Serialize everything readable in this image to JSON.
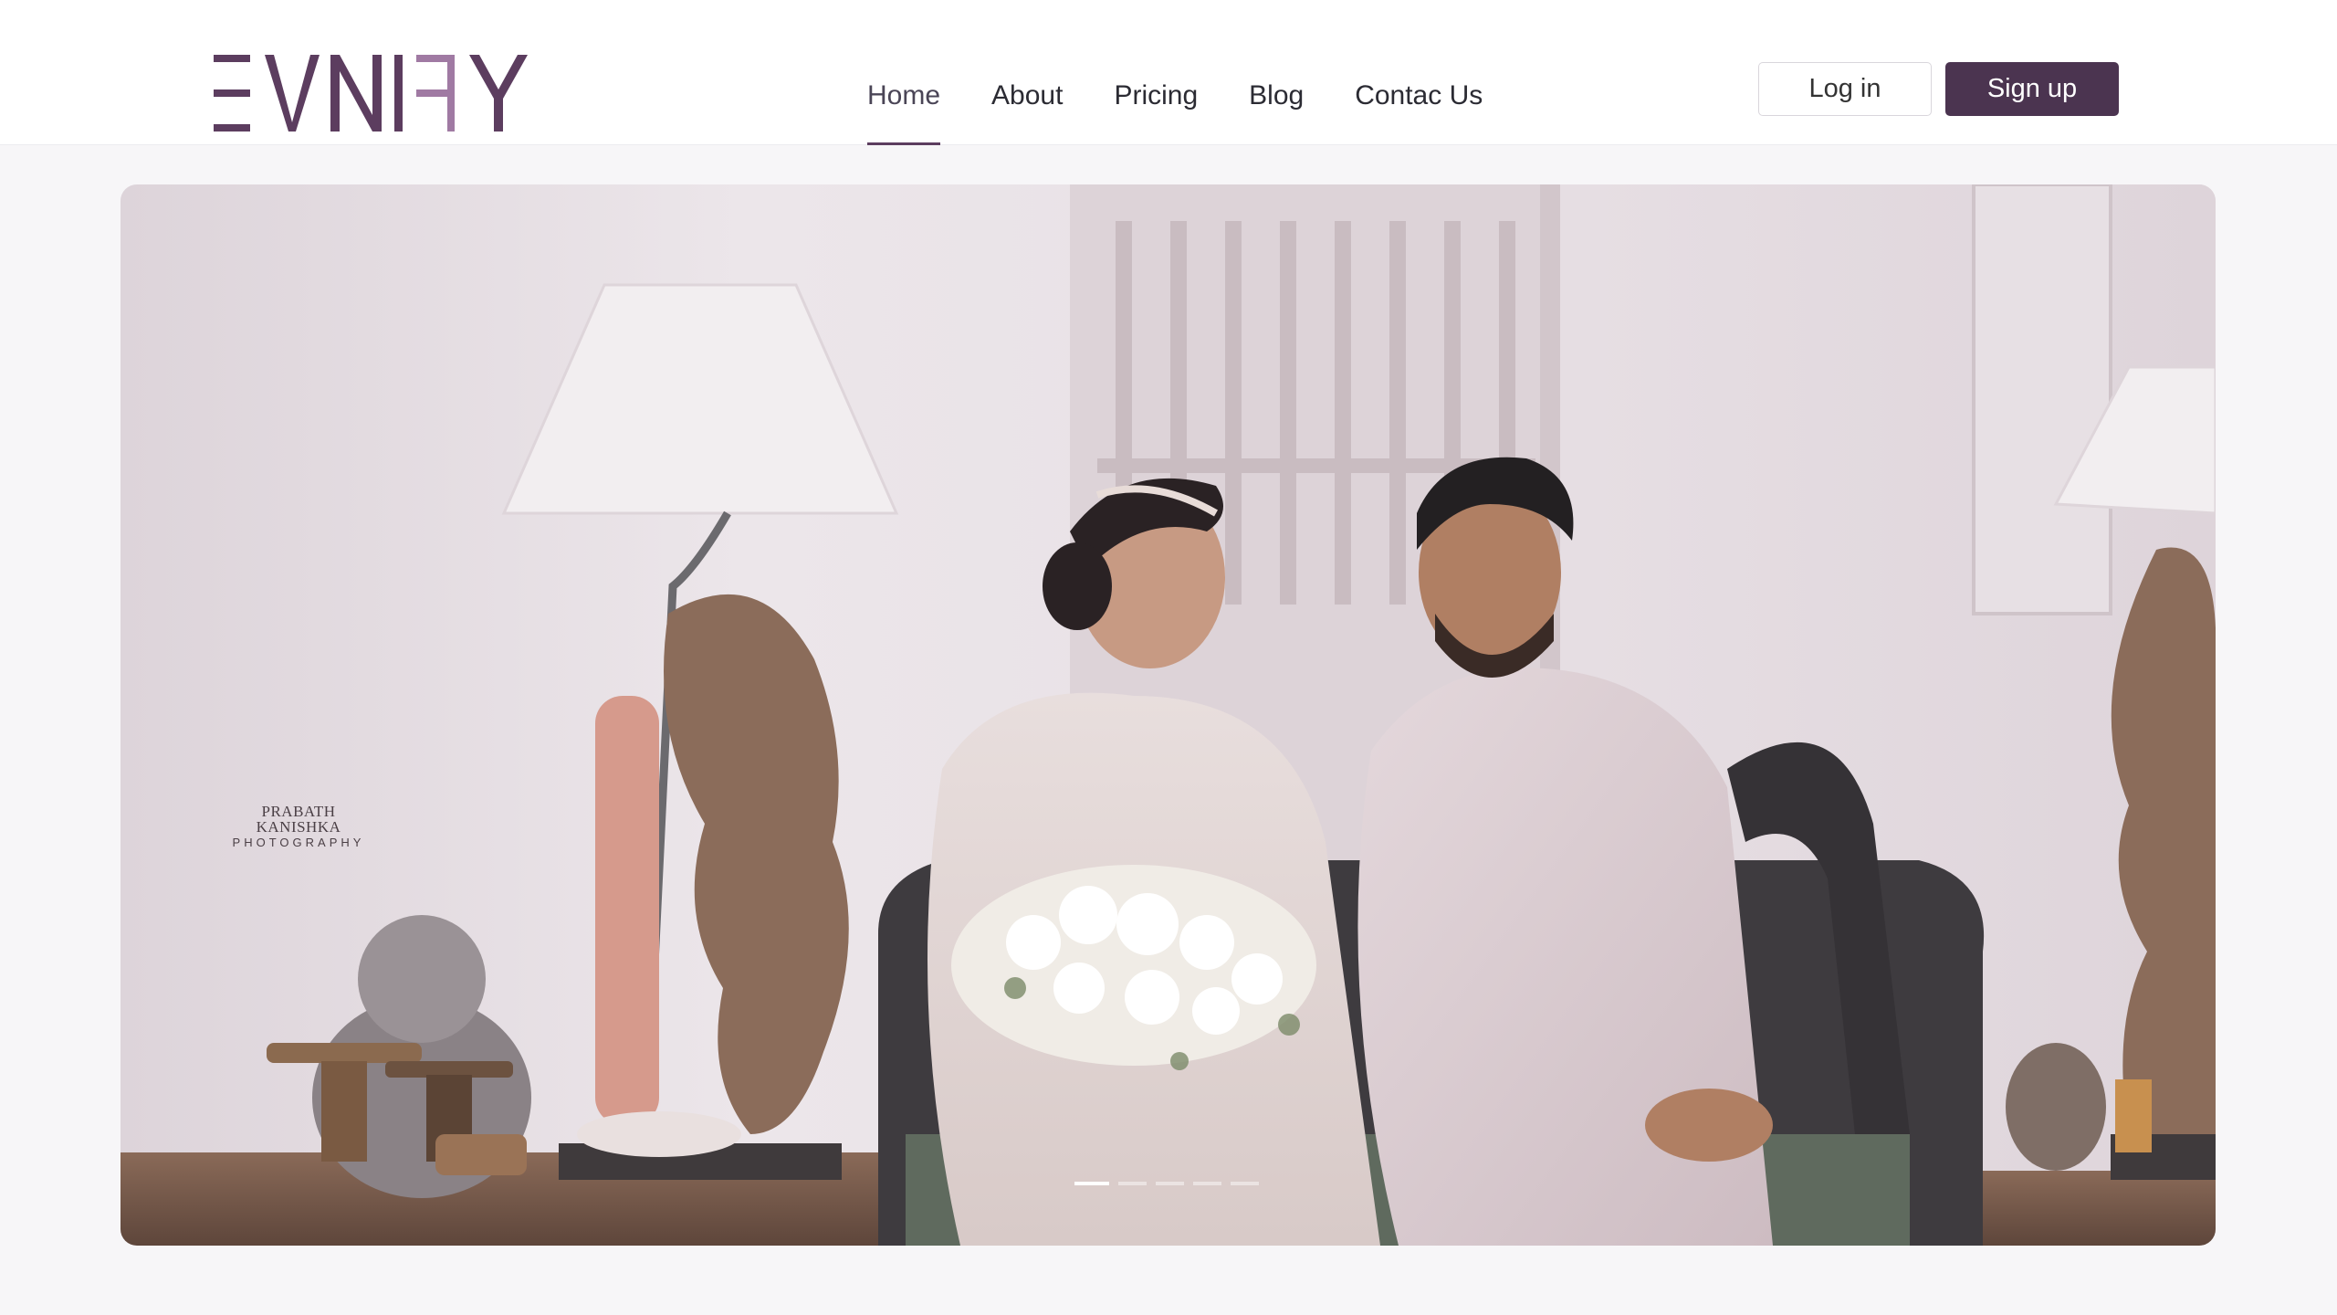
{
  "brand": {
    "logo_text": "EVNIFY",
    "color": "#5c3d5f"
  },
  "nav": {
    "items": [
      {
        "label": "Home",
        "active": true
      },
      {
        "label": "About"
      },
      {
        "label": "Pricing"
      },
      {
        "label": "Blog"
      },
      {
        "label": "Contac Us"
      }
    ]
  },
  "auth": {
    "login_label": "Log in",
    "signup_label": "Sign up"
  },
  "hero": {
    "watermark_line1": "PRABATH KANISHKA",
    "watermark_line2": "PHOTOGRAPHY",
    "slides_total": 5,
    "active_slide": 1
  },
  "colors": {
    "accent": "#4b3450",
    "page_bg": "#f7f6f8"
  }
}
